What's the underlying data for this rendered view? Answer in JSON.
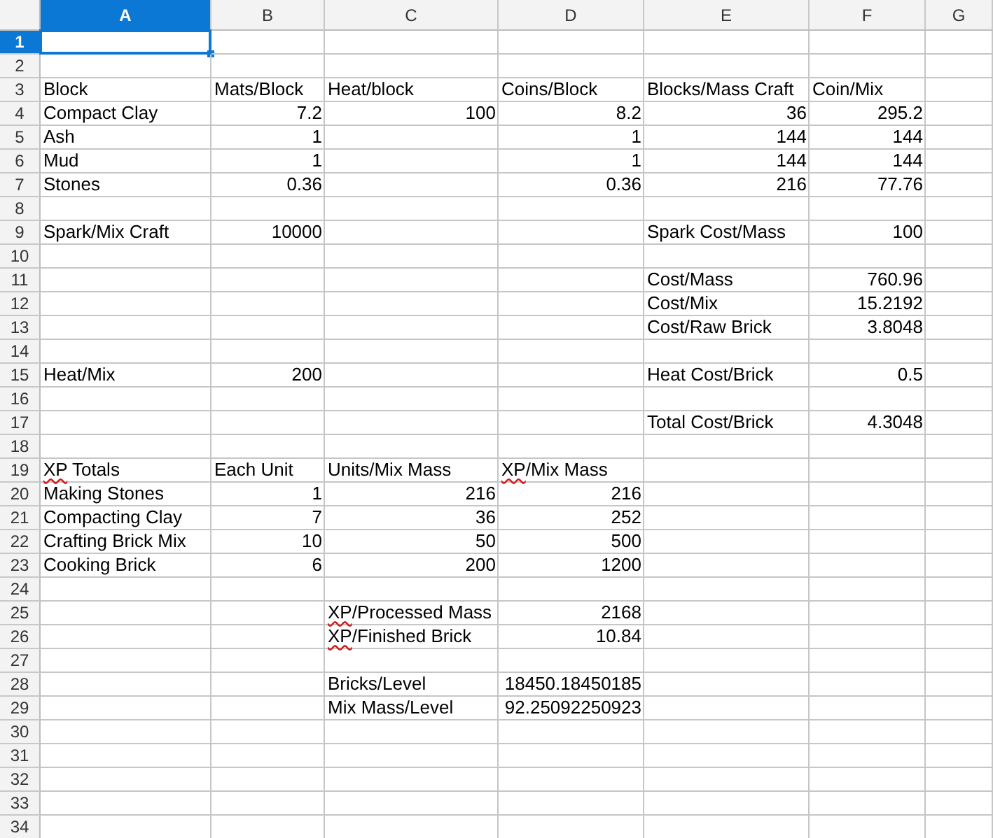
{
  "columns": [
    {
      "label": "A",
      "selected": true
    },
    {
      "label": "B",
      "selected": false
    },
    {
      "label": "C",
      "selected": false
    },
    {
      "label": "D",
      "selected": false
    },
    {
      "label": "E",
      "selected": false
    },
    {
      "label": "F",
      "selected": false
    },
    {
      "label": "G",
      "selected": false
    }
  ],
  "rows": [
    {
      "label": "1",
      "selected": true
    },
    {
      "label": "2",
      "selected": false
    },
    {
      "label": "3",
      "selected": false,
      "cells": {
        "A": {
          "text": "Block",
          "kind": "text",
          "misspelled": false
        },
        "B": {
          "text": "Mats/Block",
          "kind": "text",
          "misspelled": false
        },
        "C": {
          "text": "Heat/block",
          "kind": "text",
          "misspelled": false
        },
        "D": {
          "text": "Coins/Block",
          "kind": "text",
          "misspelled": false
        },
        "E": {
          "text": "Blocks/Mass Craft",
          "kind": "text",
          "misspelled": false
        },
        "F": {
          "text": "Coin/Mix",
          "kind": "text",
          "misspelled": false
        }
      }
    },
    {
      "label": "4",
      "selected": false,
      "cells": {
        "A": {
          "text": "Compact Clay",
          "kind": "text",
          "misspelled": false
        },
        "B": {
          "text": "7.2",
          "kind": "number",
          "misspelled": false
        },
        "C": {
          "text": "100",
          "kind": "number",
          "misspelled": false
        },
        "D": {
          "text": "8.2",
          "kind": "number",
          "misspelled": false
        },
        "E": {
          "text": "36",
          "kind": "number",
          "misspelled": false
        },
        "F": {
          "text": "295.2",
          "kind": "number",
          "misspelled": false
        }
      }
    },
    {
      "label": "5",
      "selected": false,
      "cells": {
        "A": {
          "text": "Ash",
          "kind": "text",
          "misspelled": false
        },
        "B": {
          "text": "1",
          "kind": "number",
          "misspelled": false
        },
        "D": {
          "text": "1",
          "kind": "number",
          "misspelled": false
        },
        "E": {
          "text": "144",
          "kind": "number",
          "misspelled": false
        },
        "F": {
          "text": "144",
          "kind": "number",
          "misspelled": false
        }
      }
    },
    {
      "label": "6",
      "selected": false,
      "cells": {
        "A": {
          "text": "Mud",
          "kind": "text",
          "misspelled": false
        },
        "B": {
          "text": "1",
          "kind": "number",
          "misspelled": false
        },
        "D": {
          "text": "1",
          "kind": "number",
          "misspelled": false
        },
        "E": {
          "text": "144",
          "kind": "number",
          "misspelled": false
        },
        "F": {
          "text": "144",
          "kind": "number",
          "misspelled": false
        }
      }
    },
    {
      "label": "7",
      "selected": false,
      "cells": {
        "A": {
          "text": "Stones",
          "kind": "text",
          "misspelled": false
        },
        "B": {
          "text": "0.36",
          "kind": "number",
          "misspelled": false
        },
        "D": {
          "text": "0.36",
          "kind": "number",
          "misspelled": false
        },
        "E": {
          "text": "216",
          "kind": "number",
          "misspelled": false
        },
        "F": {
          "text": "77.76",
          "kind": "number",
          "misspelled": false
        }
      }
    },
    {
      "label": "8",
      "selected": false
    },
    {
      "label": "9",
      "selected": false,
      "cells": {
        "A": {
          "text": "Spark/Mix Craft",
          "kind": "text",
          "misspelled": false
        },
        "B": {
          "text": "10000",
          "kind": "number",
          "misspelled": false
        },
        "E": {
          "text": "Spark Cost/Mass",
          "kind": "text",
          "misspelled": false
        },
        "F": {
          "text": "100",
          "kind": "number",
          "misspelled": false
        }
      }
    },
    {
      "label": "10",
      "selected": false
    },
    {
      "label": "11",
      "selected": false,
      "cells": {
        "E": {
          "text": "Cost/Mass",
          "kind": "text",
          "misspelled": false
        },
        "F": {
          "text": "760.96",
          "kind": "number",
          "misspelled": false
        }
      }
    },
    {
      "label": "12",
      "selected": false,
      "cells": {
        "E": {
          "text": "Cost/Mix",
          "kind": "text",
          "misspelled": false
        },
        "F": {
          "text": "15.2192",
          "kind": "number",
          "misspelled": false
        }
      }
    },
    {
      "label": "13",
      "selected": false,
      "cells": {
        "E": {
          "text": "Cost/Raw Brick",
          "kind": "text",
          "misspelled": false
        },
        "F": {
          "text": "3.8048",
          "kind": "number",
          "misspelled": false
        }
      }
    },
    {
      "label": "14",
      "selected": false
    },
    {
      "label": "15",
      "selected": false,
      "cells": {
        "A": {
          "text": "Heat/Mix",
          "kind": "text",
          "misspelled": false
        },
        "B": {
          "text": "200",
          "kind": "number",
          "misspelled": false
        },
        "E": {
          "text": "Heat Cost/Brick",
          "kind": "text",
          "misspelled": false
        },
        "F": {
          "text": "0.5",
          "kind": "number",
          "misspelled": false
        }
      }
    },
    {
      "label": "16",
      "selected": false
    },
    {
      "label": "17",
      "selected": false,
      "cells": {
        "E": {
          "text": "Total Cost/Brick",
          "kind": "text",
          "misspelled": false
        },
        "F": {
          "text": "4.3048",
          "kind": "number",
          "misspelled": false
        }
      }
    },
    {
      "label": "18",
      "selected": false
    },
    {
      "label": "19",
      "selected": false,
      "cells": {
        "A": {
          "text": "XP Totals",
          "kind": "text",
          "misspelled": true
        },
        "B": {
          "text": "Each Unit",
          "kind": "text",
          "misspelled": false
        },
        "C": {
          "text": "Units/Mix Mass",
          "kind": "text",
          "misspelled": false
        },
        "D": {
          "text": "XP/Mix Mass",
          "kind": "text",
          "misspelled": true
        }
      }
    },
    {
      "label": "20",
      "selected": false,
      "cells": {
        "A": {
          "text": "Making Stones",
          "kind": "text",
          "misspelled": false
        },
        "B": {
          "text": "1",
          "kind": "number",
          "misspelled": false
        },
        "C": {
          "text": "216",
          "kind": "number",
          "misspelled": false
        },
        "D": {
          "text": "216",
          "kind": "number",
          "misspelled": false
        }
      }
    },
    {
      "label": "21",
      "selected": false,
      "cells": {
        "A": {
          "text": "Compacting Clay",
          "kind": "text",
          "misspelled": false
        },
        "B": {
          "text": "7",
          "kind": "number",
          "misspelled": false
        },
        "C": {
          "text": "36",
          "kind": "number",
          "misspelled": false
        },
        "D": {
          "text": "252",
          "kind": "number",
          "misspelled": false
        }
      }
    },
    {
      "label": "22",
      "selected": false,
      "cells": {
        "A": {
          "text": "Crafting Brick Mix",
          "kind": "text",
          "misspelled": false
        },
        "B": {
          "text": "10",
          "kind": "number",
          "misspelled": false
        },
        "C": {
          "text": "50",
          "kind": "number",
          "misspelled": false
        },
        "D": {
          "text": "500",
          "kind": "number",
          "misspelled": false
        }
      }
    },
    {
      "label": "23",
      "selected": false,
      "cells": {
        "A": {
          "text": "Cooking Brick",
          "kind": "text",
          "misspelled": false
        },
        "B": {
          "text": "6",
          "kind": "number",
          "misspelled": false
        },
        "C": {
          "text": "200",
          "kind": "number",
          "misspelled": false
        },
        "D": {
          "text": "1200",
          "kind": "number",
          "misspelled": false
        }
      }
    },
    {
      "label": "24",
      "selected": false
    },
    {
      "label": "25",
      "selected": false,
      "cells": {
        "C": {
          "text": "XP/Processed Mass",
          "kind": "text",
          "misspelled": true
        },
        "D": {
          "text": "2168",
          "kind": "number",
          "misspelled": false
        }
      }
    },
    {
      "label": "26",
      "selected": false,
      "cells": {
        "C": {
          "text": "XP/Finished Brick",
          "kind": "text",
          "misspelled": true
        },
        "D": {
          "text": "10.84",
          "kind": "number",
          "misspelled": false
        }
      }
    },
    {
      "label": "27",
      "selected": false
    },
    {
      "label": "28",
      "selected": false,
      "cells": {
        "C": {
          "text": "Bricks/Level",
          "kind": "text",
          "misspelled": false
        },
        "D": {
          "text": "18450.18450185",
          "kind": "number",
          "misspelled": false
        }
      }
    },
    {
      "label": "29",
      "selected": false,
      "cells": {
        "C": {
          "text": "Mix Mass/Level",
          "kind": "text",
          "misspelled": false
        },
        "D": {
          "text": "92.25092250923",
          "kind": "number",
          "misspelled": false
        }
      }
    },
    {
      "label": "30",
      "selected": false
    },
    {
      "label": "31",
      "selected": false
    },
    {
      "label": "32",
      "selected": false
    },
    {
      "label": "33",
      "selected": false
    },
    {
      "label": "34",
      "selected": false
    }
  ]
}
